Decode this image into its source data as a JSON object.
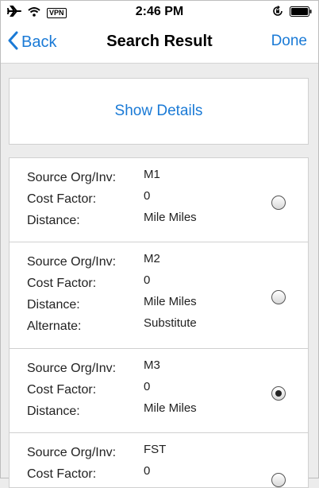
{
  "status_bar": {
    "vpn": "VPN",
    "time": "2:46 PM"
  },
  "nav": {
    "back_label": "Back",
    "title": "Search Result",
    "done_label": "Done"
  },
  "show_details_label": "Show Details",
  "results": [
    {
      "selected": false,
      "fields": [
        {
          "label": "Source Org/Inv:",
          "value": "M1"
        },
        {
          "label": "Cost Factor:",
          "value": "0"
        },
        {
          "label": "Distance:",
          "value": "Mile Miles"
        }
      ]
    },
    {
      "selected": false,
      "fields": [
        {
          "label": "Source Org/Inv:",
          "value": "M2"
        },
        {
          "label": "Cost Factor:",
          "value": "0"
        },
        {
          "label": "Distance:",
          "value": "Mile Miles"
        },
        {
          "label": "Alternate:",
          "value": "Substitute"
        }
      ]
    },
    {
      "selected": true,
      "fields": [
        {
          "label": "Source Org/Inv:",
          "value": "M3"
        },
        {
          "label": "Cost Factor:",
          "value": "0"
        },
        {
          "label": "Distance:",
          "value": "Mile Miles"
        }
      ]
    },
    {
      "selected": false,
      "fields": [
        {
          "label": "Source Org/Inv:",
          "value": "FST"
        },
        {
          "label": "Cost Factor:",
          "value": "0"
        }
      ]
    }
  ],
  "colors": {
    "accent": "#1a7ad6",
    "background": "#ececec"
  },
  "icons": {
    "airplane": "airplane-icon",
    "wifi": "wifi-icon",
    "rotation_lock": "rotation-lock-icon",
    "battery": "battery-icon",
    "back_chevron": "chevron-left-icon"
  }
}
